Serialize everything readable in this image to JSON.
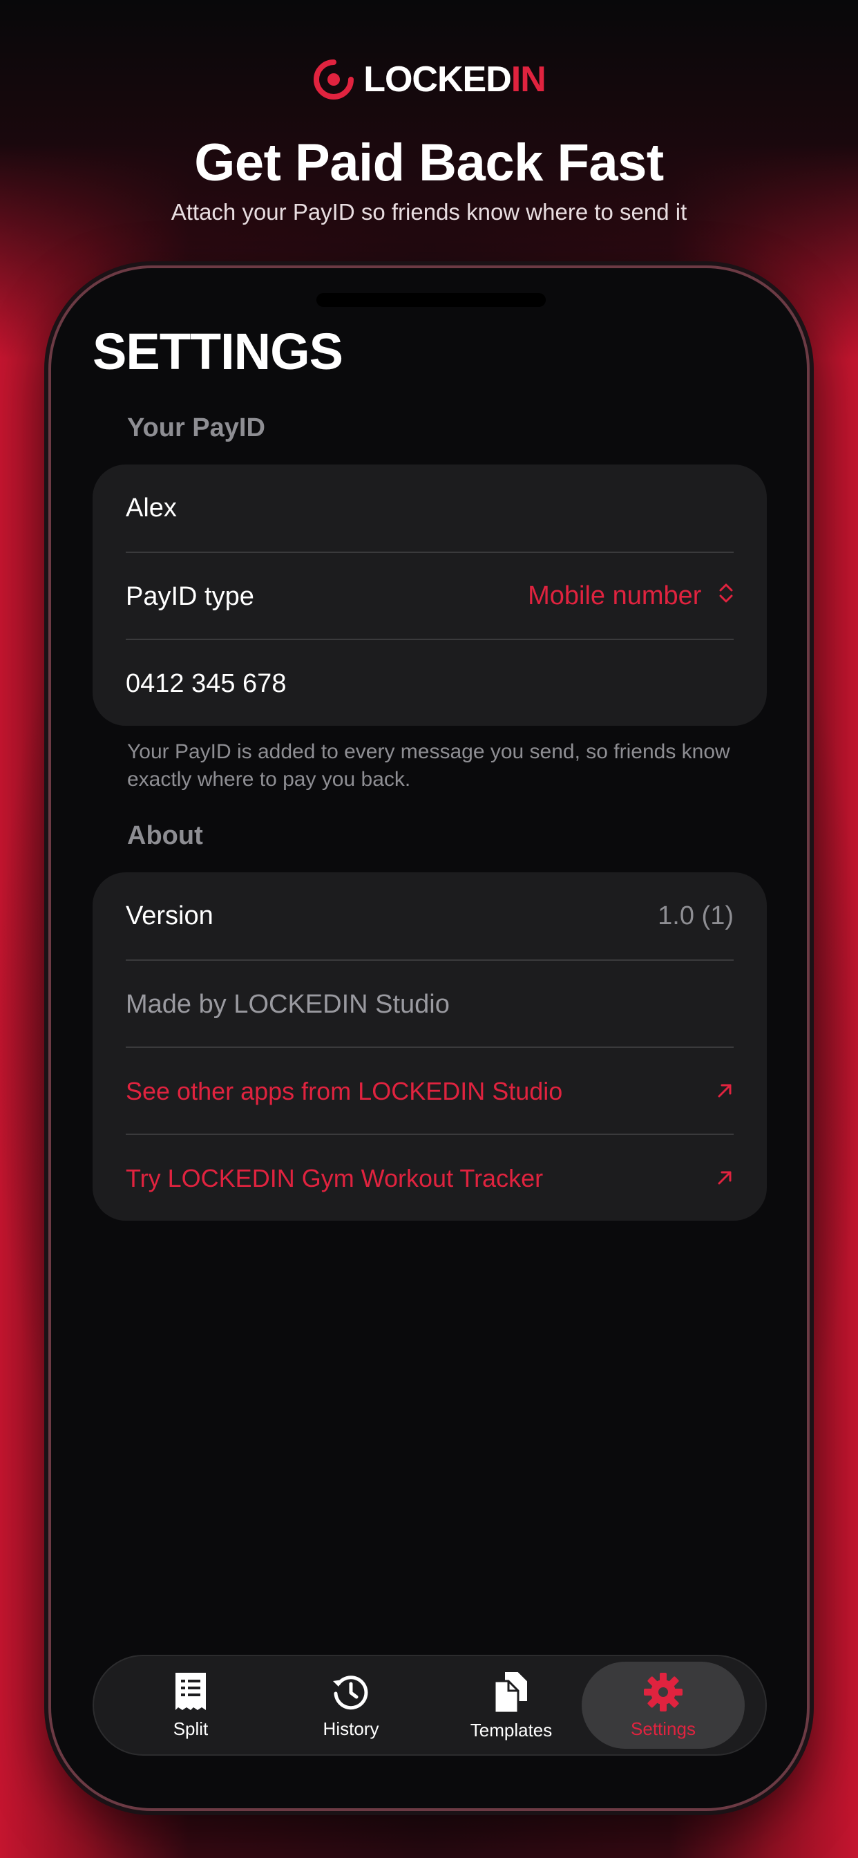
{
  "brand": {
    "name_main": "LOCKED",
    "name_accent": "IN",
    "accent_color": "#e0233f"
  },
  "promo": {
    "headline": "Get Paid Back Fast",
    "subline": "Attach your PayID so friends know where to send it"
  },
  "screen": {
    "title": "SETTINGS",
    "payid_section": {
      "label": "Your PayID",
      "name_value": "Alex",
      "type_label": "PayID type",
      "type_value": "Mobile number",
      "number_value": "0412 345 678",
      "footnote": "Your PayID is added to every message you send, so friends know exactly where to pay you back."
    },
    "about_section": {
      "label": "About",
      "version_label": "Version",
      "version_value": "1.0 (1)",
      "made_by": "Made by LOCKEDIN Studio",
      "link_other_apps": "See other apps from LOCKEDIN Studio",
      "link_gym": "Try LOCKEDIN Gym Workout Tracker"
    }
  },
  "tabbar": {
    "tabs": [
      {
        "label": "Split",
        "icon": "receipt-icon"
      },
      {
        "label": "History",
        "icon": "history-icon"
      },
      {
        "label": "Templates",
        "icon": "documents-icon"
      },
      {
        "label": "Settings",
        "icon": "gear-icon",
        "active": true
      }
    ]
  }
}
